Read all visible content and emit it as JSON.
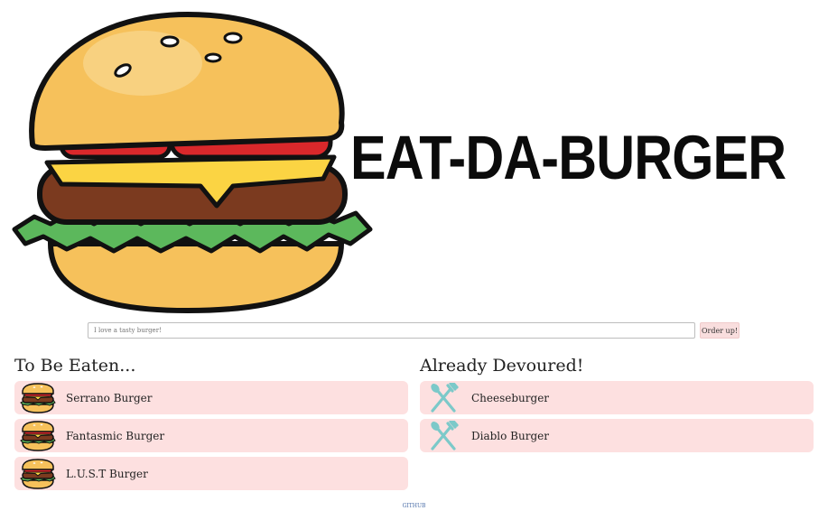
{
  "header": {
    "title": "EAT-DA-BURGER"
  },
  "order_form": {
    "placeholder": "I love a tasty burger!",
    "button_label": "Order up!"
  },
  "to_be_eaten": {
    "heading": "To Be Eaten...",
    "icon": "burger-icon",
    "items": [
      {
        "label": "Serrano Burger"
      },
      {
        "label": "Fantasmic Burger"
      },
      {
        "label": "L.U.S.T Burger"
      }
    ]
  },
  "devoured": {
    "heading": "Already Devoured!",
    "icon": "fork-spoon-icon",
    "items": [
      {
        "label": "Cheeseburger"
      },
      {
        "label": "Diablo Burger"
      }
    ]
  },
  "footer": {
    "link_label": "GITHUB"
  },
  "colors": {
    "item_bg": "#fde0e0",
    "button_bg": "#f9dede",
    "title": "#0b0b0b",
    "utensil": "#7cc9c9"
  }
}
